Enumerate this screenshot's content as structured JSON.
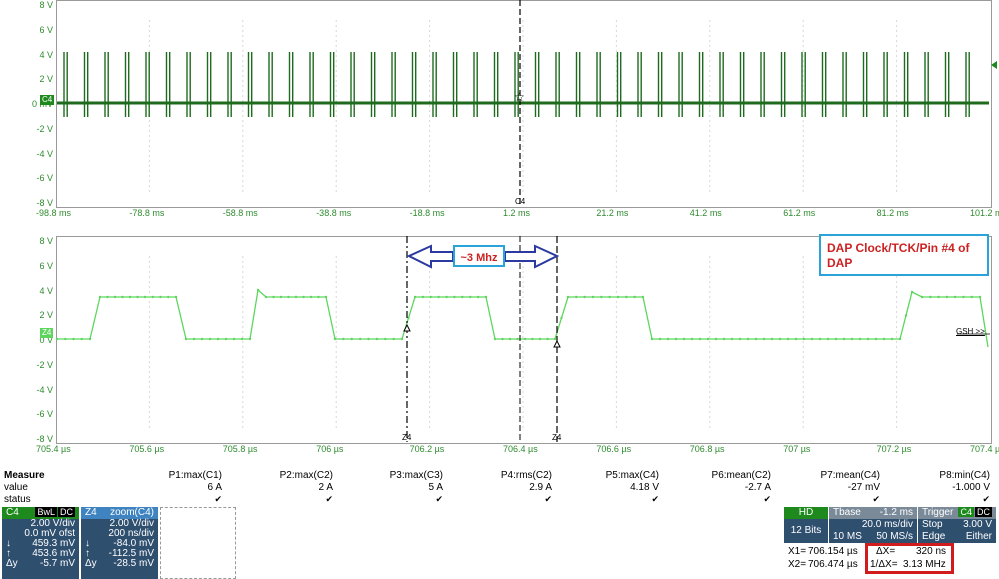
{
  "top_chart": {
    "y_ticks": [
      "8 V",
      "6 V",
      "4 V",
      "2 V",
      "0 mV",
      "-2 V",
      "-4 V",
      "-6 V",
      "-8 V"
    ],
    "x_ticks": [
      "-98.8 ms",
      "-78.8 ms",
      "-58.8 ms",
      "-38.8 ms",
      "-18.8 ms",
      "1.2 ms",
      "21.2 ms",
      "41.2 ms",
      "61.2 ms",
      "81.2 ms",
      "101.2 ms"
    ],
    "channel_tag": "C4",
    "cursor_label": "C4",
    "color": "#1e6b1e"
  },
  "bottom_chart": {
    "y_ticks": [
      "8 V",
      "6 V",
      "4 V",
      "2 V",
      "0 V",
      "-2 V",
      "-4 V",
      "-6 V",
      "-8 V"
    ],
    "x_ticks": [
      "705.4 µs",
      "705.6 µs",
      "705.8 µs",
      "706 µs",
      "706.2 µs",
      "706.4 µs",
      "706.6 µs",
      "706.8 µs",
      "707 µs",
      "707.2 µs",
      "707.4 µs"
    ],
    "channel_tag": "Z4",
    "cursor1_label": "Z4",
    "cursor2_label": "Z4",
    "gsh_label": "GSH >>",
    "freq_annotation": "~3 Mhz",
    "note": "DAP Clock/TCK/Pin #4 of DAP",
    "color": "#5ed65e",
    "annotation_text_color": "#cc2222"
  },
  "measure": {
    "title": "Measure",
    "row_labels": [
      "value",
      "status"
    ],
    "params": [
      {
        "name": "P1:max(C1)",
        "value": "6 A"
      },
      {
        "name": "P2:max(C2)",
        "value": "2 A"
      },
      {
        "name": "P3:max(C3)",
        "value": "5 A"
      },
      {
        "name": "P4:rms(C2)",
        "value": "2.9 A"
      },
      {
        "name": "P5:max(C4)",
        "value": "4.18 V"
      },
      {
        "name": "P6:mean(C2)",
        "value": "-2.7 A"
      },
      {
        "name": "P7:mean(C4)",
        "value": "-27 mV"
      },
      {
        "name": "P8:min(C4)",
        "value": "-1.000 V"
      }
    ],
    "status_mark": "✔"
  },
  "c4_panel": {
    "name": "C4",
    "tags": [
      "BwL",
      "DC"
    ],
    "vdiv": "2.00 V/div",
    "offset": "0.0 mV ofst",
    "cursor1": "459.3 mV",
    "cursor2": "453.6 mV",
    "delta_label": "Δy",
    "delta": "-5.7 mV"
  },
  "z4_panel": {
    "name": "Z4",
    "source": "zoom(C4)",
    "vdiv": "2.00 V/div",
    "tdiv": "200 ns/div",
    "cursor1": "-84.0 mV",
    "cursor2": "-112.5 mV",
    "delta_label": "Δy",
    "delta": "-28.5 mV"
  },
  "timebase": {
    "hd": "HD",
    "bits": "12 Bits",
    "tbase_label": "Tbase",
    "tbase_value": "-1.2 ms",
    "tdiv": "20.0 ms/div",
    "points": "10 MS",
    "rate": "50 MS/s",
    "trigger_label": "Trigger",
    "trigger_tags": [
      "C4",
      "DC"
    ],
    "trigger_mode": "Stop",
    "trigger_level": "3.00 V",
    "trigger_type": "Edge",
    "trigger_slope": "Either"
  },
  "cursors": {
    "x1_label": "X1=",
    "x1_value": "706.154 µs",
    "x2_label": "X2=",
    "x2_value": "706.474 µs",
    "dx_label": "ΔX=",
    "dx_value": "320 ns",
    "inv_dx_label": "1/ΔX=",
    "inv_dx_value": "3.13 MHz",
    "highlight_color": "#d01c1c"
  }
}
